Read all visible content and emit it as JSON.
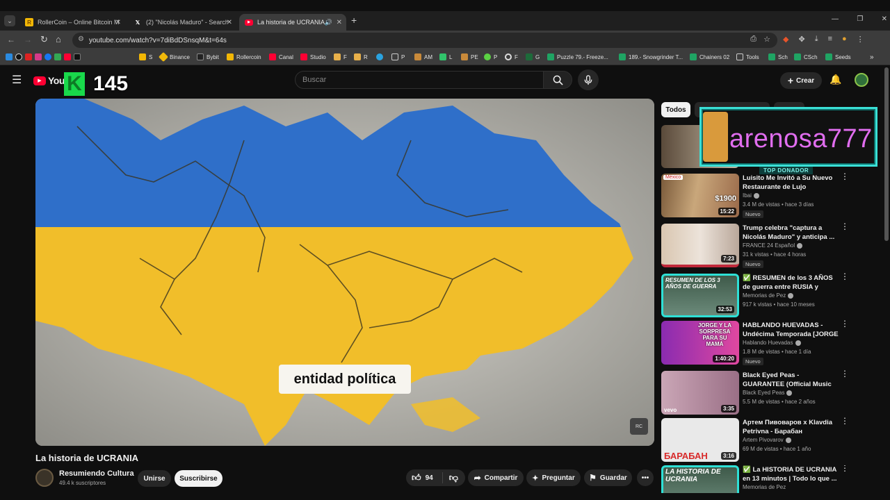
{
  "browser": {
    "tabs": [
      {
        "title": "RollerCoin – Online Bitcoin Mi",
        "icon": "rollercoin-icon",
        "active": false
      },
      {
        "title": "(2) \"Nicolás Maduro\" - Search /",
        "icon": "x-icon",
        "active": false
      },
      {
        "title": "La historia de UCRANIA - Yo",
        "icon": "youtube-icon",
        "active": true
      }
    ],
    "new_tab": "+",
    "url": "youtube.com/watch?v=7diBdDSnsqM&t=64s",
    "bookmarks": [
      "S",
      "Binance",
      "Bybit",
      "Rollercoin",
      "Canal",
      "Studio",
      "F",
      "R",
      "P",
      "AM",
      "L",
      "PE",
      "P",
      "F",
      "G",
      "Puzzle 79.- Freeze...",
      "189.- Snowgrinder T...",
      "Chainers 02",
      "Tools",
      "Sch",
      "CSch",
      "Seeds"
    ]
  },
  "youtube": {
    "logo_text": "YouTu",
    "search_placeholder": "Buscar",
    "create_label": "Crear",
    "overlay_counter": "145",
    "overlay_letter": "K"
  },
  "video": {
    "caption": "entidad política",
    "watermark": "RC",
    "title": "La historia de UCRANIA",
    "channel": "Resumiendo Cultura",
    "subscribers": "49.4 k suscriptores",
    "join_label": "Unirse",
    "subscribe_label": "Suscribirse",
    "likes": "94",
    "share_label": "Compartir",
    "ask_label": "Preguntar",
    "save_label": "Guardar"
  },
  "sidebar": {
    "chip_all": "Todos",
    "donor": {
      "name": "arenosa777",
      "label": "TOP DONADOR"
    },
    "items": [
      {
        "title": "Luisito Me Invitó a Su Nuevo Restaurante de Lujo",
        "channel": "Ibai",
        "stats": "3.4 M de vistas • hace 3 días",
        "duration": "15:22",
        "badge": "Nuevo",
        "thumb_tag": "México",
        "thumb_price": "$1900"
      },
      {
        "title": "Trump celebra \"captura a Nicolás Maduro\" y anticipa ...",
        "channel": "FRANCE 24 Español",
        "stats": "31 k vistas • hace 4 horas",
        "duration": "7:23",
        "badge": "Nuevo"
      },
      {
        "title": "✅ RESUMEN de los 3 AÑOS de guerra entre RUSIA y UCRANIA",
        "channel": "Memorias de Pez",
        "stats": "917 k vistas • hace 10 meses",
        "duration": "32:53",
        "badge": "",
        "thumb_text": "RESUMEN DE LOS 3 AÑOS DE GUERRA"
      },
      {
        "title": "HABLANDO HUEVADAS - Undécima Temporada [JORGE ...",
        "channel": "Hablando Huevadas",
        "stats": "1.8 M de vistas • hace 1 día",
        "duration": "1:40:20",
        "badge": "Nuevo",
        "thumb_text": "JORGE Y LA SORPRESA PARA SU MAMÁ"
      },
      {
        "title": "Black Eyed Peas - GUARANTEE (Official Music Video) ft. J. Re...",
        "channel": "Black Eyed Peas",
        "stats": "5.5 M de vistas • hace 2 años",
        "duration": "3:35",
        "badge": "",
        "thumb_text": "vevo"
      },
      {
        "title": "Артем Пивоваров x Klavdia Petrivna - Барабан",
        "channel": "Artem Pivovarov",
        "stats": "69 M de vistas • hace 1 año",
        "duration": "3:16",
        "badge": "",
        "thumb_text": "БАРАБАН"
      },
      {
        "title": "✅ La HISTORIA DE UCRANIA en 13 minutos | Todo lo que ...",
        "channel": "Memorias de Pez",
        "stats": "",
        "duration": "",
        "badge": "",
        "thumb_text": "LA HISTORIA DE UCRANIA"
      }
    ]
  }
}
